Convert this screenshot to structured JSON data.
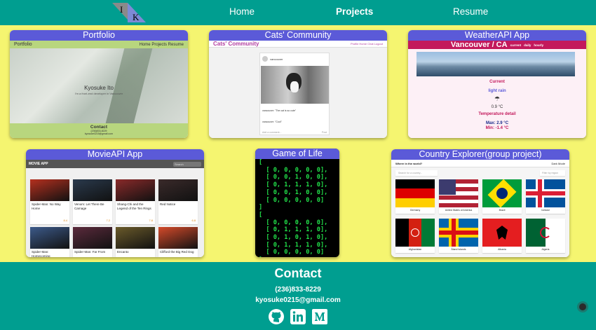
{
  "nav": {
    "home": "Home",
    "projects": "Projects",
    "resume": "Resume"
  },
  "logo": {
    "letter_left": "I",
    "letter_right": "K"
  },
  "projects": {
    "portfolio": {
      "title": "Portfolio",
      "brand": "Portfolio",
      "links": "Home   Projects   Resume",
      "name": "Kyosuke Ito",
      "tagline": "I'm a front-end developer in Vancouver",
      "contact": "Contact",
      "phone": "(236)833-8229",
      "email": "kyosuke0215@gmail.com"
    },
    "cats": {
      "title": "Cats' Community",
      "brand": "Cats' Community",
      "links": "Profile   Home   Chat   Logout",
      "user": "vancouver",
      "caption": "vancouver: \"The cat is so cute\"",
      "comment": "vancouver: \"Cool\"",
      "input_placeholder": "Add a comment...",
      "post_label": "Post"
    },
    "weather": {
      "title": "WeatherAPI App",
      "city": "Vancouver / CA",
      "tabs": [
        "current",
        "daily",
        "hourly"
      ],
      "current_label": "Current",
      "condition": "light rain",
      "temperature": "0.9 °C",
      "detail_label": "Temperature detail",
      "max": "Max: 2.9 °C",
      "min": "Min: -1.4 °C"
    },
    "movie": {
      "title": "MovieAPI App",
      "brand": "MOVIE APP",
      "search": "Search",
      "movies": [
        {
          "title": "Spider-Man: No Way Home",
          "rating": "8.4",
          "color": "#b5301f"
        },
        {
          "title": "Venom: Let There Be Carnage",
          "rating": "7.2",
          "color": "#2a3a4d"
        },
        {
          "title": "Shang-Chi and the Legend of the Ten Rings",
          "rating": "7.8",
          "color": "#8a2a2a"
        },
        {
          "title": "Red Notice",
          "rating": "6.8",
          "color": "#3a2a2a"
        },
        {
          "title": "Spider-Man: Homecoming",
          "rating": "",
          "color": "#3c5a8a"
        },
        {
          "title": "Spider-Man: Far From",
          "rating": "",
          "color": "#5b2a3c"
        },
        {
          "title": "Encanto",
          "rating": "",
          "color": "#6a5a2a"
        },
        {
          "title": "Clifford the Big Red Dog",
          "rating": "",
          "color": "#d44a2a"
        }
      ]
    },
    "gol": {
      "title": "Game of Life",
      "code": "[\n  [ 0, 0, 0, 0, 0],\n  [ 0, 0, 1, 0, 0],\n  [ 0, 1, 1, 1, 0],\n  [ 0, 0, 1, 0, 0],\n  [ 0, 0, 0, 0, 0]\n]\n[\n  [ 0, 0, 0, 0, 0],\n  [ 0, 1, 1, 1, 0],\n  [ 0, 1, 0, 1, 0],\n  [ 0, 1, 1, 1, 0],\n  [ 0, 0, 0, 0, 0]\n]"
    },
    "country": {
      "title": "Country Explorer(group project)",
      "header": "Where in the world?",
      "mode": "Dark Mode",
      "search": "Search for a country...",
      "filter": "Filter by region",
      "countries": [
        "Germany",
        "United States of America",
        "Brazil",
        "Iceland",
        "Afghanistan",
        "Åland Islands",
        "Albania",
        "Algeria"
      ]
    }
  },
  "footer": {
    "title": "Contact",
    "phone": "(236)833-8229",
    "email": "kyosuke0215@gmail.com",
    "icons": [
      "github-icon",
      "linkedin-icon",
      "medium-icon"
    ]
  }
}
